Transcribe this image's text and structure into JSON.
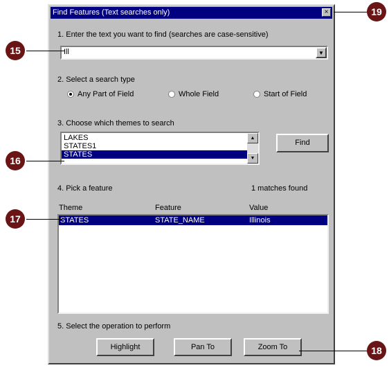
{
  "window": {
    "title": "Find Features (Text searches only)",
    "close_symbol": "×"
  },
  "step1": {
    "label": "1. Enter the text you want to find (searches are case-sensitive)",
    "input_value": "Ill",
    "dropdown_symbol": "▼"
  },
  "step2": {
    "label": "2. Select a search type",
    "options": [
      {
        "label": "Any Part of Field",
        "selected": true
      },
      {
        "label": "Whole Field",
        "selected": false
      },
      {
        "label": "Start of Field",
        "selected": false
      }
    ]
  },
  "step3": {
    "label": "3. Choose which themes to search",
    "themes": [
      {
        "label": "LAKES",
        "selected": false
      },
      {
        "label": "STATES1",
        "selected": false
      },
      {
        "label": "STATES",
        "selected": true
      }
    ],
    "scroll_up": "▲",
    "scroll_down": "▼",
    "find_label": "Find"
  },
  "step4": {
    "label": "4. Pick a feature",
    "match_count": "1 matches found",
    "columns": [
      "Theme",
      "Feature",
      "Value"
    ],
    "rows": [
      {
        "theme": "STATES",
        "feature": "STATE_NAME",
        "value": "Illinois",
        "selected": true
      }
    ]
  },
  "step5": {
    "label": "5. Select the operation to perform",
    "buttons": [
      "Highlight",
      "Pan To",
      "Zoom To"
    ]
  },
  "callouts": {
    "c15": "15",
    "c16": "16",
    "c17": "17",
    "c18": "18",
    "c19": "19"
  },
  "colors": {
    "titlebar": "#000080",
    "selection": "#000080",
    "dialog_face": "#c0c0c0",
    "callout": "#6a1515"
  }
}
